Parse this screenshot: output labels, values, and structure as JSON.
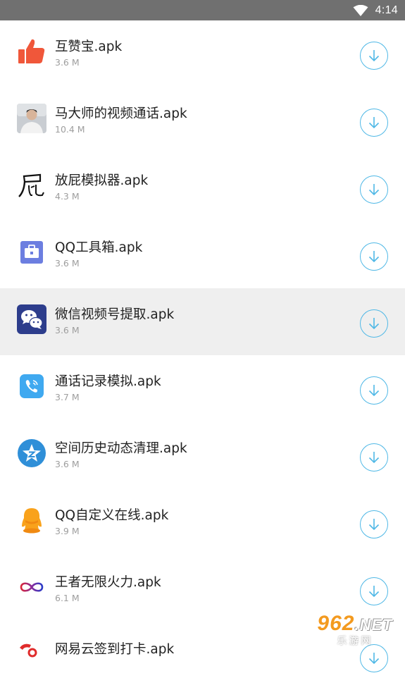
{
  "status_bar": {
    "time": "4:14",
    "wifi_icon": "wifi-icon"
  },
  "files": [
    {
      "name": "互赞宝.apk",
      "size": "3.6 M",
      "icon": "thumbs-up-icon"
    },
    {
      "name": "马大师的视频通话.apk",
      "size": "10.4 M",
      "icon": "person-photo-icon"
    },
    {
      "name": "放屁模拟器.apk",
      "size": "4.3 M",
      "icon": "calligraphy-icon"
    },
    {
      "name": "QQ工具箱.apk",
      "size": "3.6 M",
      "icon": "toolbox-icon"
    },
    {
      "name": "微信视频号提取.apk",
      "size": "3.6 M",
      "icon": "wechat-icon",
      "highlighted": true
    },
    {
      "name": "通话记录模拟.apk",
      "size": "3.7 M",
      "icon": "phone-call-icon"
    },
    {
      "name": "空间历史动态清理.apk",
      "size": "3.6 M",
      "icon": "qzone-star-icon"
    },
    {
      "name": "QQ自定义在线.apk",
      "size": "3.9 M",
      "icon": "qq-penguin-icon"
    },
    {
      "name": "王者无限火力.apk",
      "size": "6.1 M",
      "icon": "infinity-icon"
    },
    {
      "name": "网易云签到打卡.apk",
      "size": "",
      "icon": "netease-music-icon"
    }
  ],
  "watermark": {
    "top": "962",
    "net": ".NET",
    "bottom": "乐游网"
  },
  "colors": {
    "accent": "#4fb8e6",
    "highlight": "#efefef",
    "status_bar": "#707070"
  }
}
